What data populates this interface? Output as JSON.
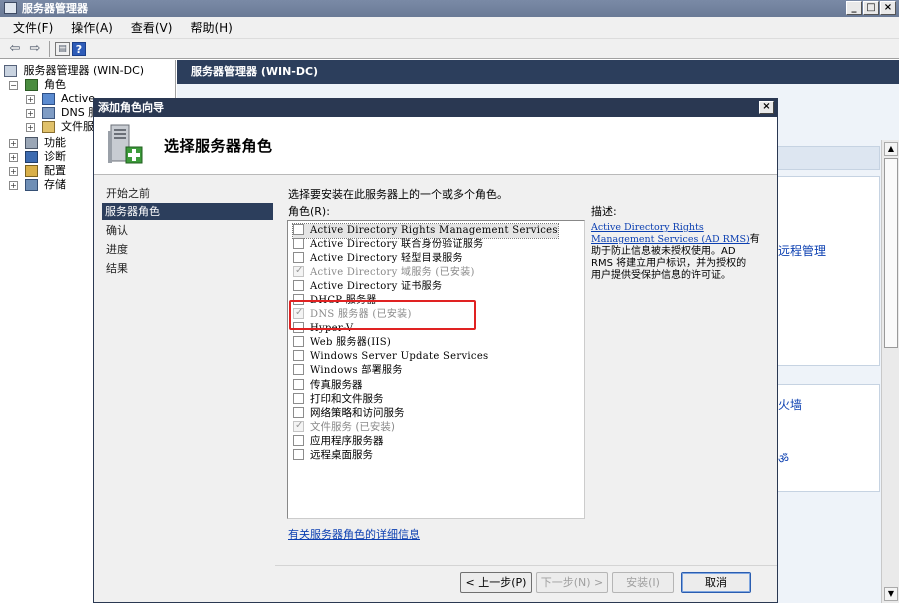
{
  "window": {
    "title": "服务器管理器",
    "controls": [
      "_",
      "□",
      "×"
    ]
  },
  "menubar": {
    "items": [
      "文件(F)",
      "操作(A)",
      "查看(V)",
      "帮助(H)"
    ]
  },
  "toolbar": {
    "back": "⇦",
    "forward": "⇨",
    "help": "?"
  },
  "tree": {
    "root": "服务器管理器 (WIN-DC)",
    "roles": "角色",
    "roles_children": [
      "Active",
      "DNS 服",
      "文件服"
    ],
    "items": [
      "功能",
      "诊断",
      "配置",
      "存储"
    ]
  },
  "right": {
    "header": "服务器管理器 (WIN-DC)",
    "links": [
      "远程管理",
      "火墙",
      "ॐ"
    ]
  },
  "dialog": {
    "title": "添加角色向导",
    "close": "×",
    "heading": "选择服务器角色",
    "steps": [
      "开始之前",
      "服务器角色",
      "确认",
      "进度",
      "结果"
    ],
    "instruction": "选择要安装在此服务器上的一个或多个角色。",
    "roles_label": "角色(R):",
    "description_label": "描述:",
    "roles": [
      {
        "label": "Active Directory Rights Management Services",
        "checked": false,
        "disabled": false
      },
      {
        "label": "Active Directory 联合身份验证服务",
        "checked": false,
        "disabled": false
      },
      {
        "label": "Active Directory 轻型目录服务",
        "checked": false,
        "disabled": false
      },
      {
        "label": "Active Directory 域服务  (已安装)",
        "checked": true,
        "disabled": true
      },
      {
        "label": "Active Directory 证书服务",
        "checked": false,
        "disabled": false
      },
      {
        "label": "DHCP 服务器",
        "checked": false,
        "disabled": false
      },
      {
        "label": "DNS 服务器  (已安装)",
        "checked": true,
        "disabled": true
      },
      {
        "label": "Hyper-V",
        "checked": false,
        "disabled": false
      },
      {
        "label": "Web 服务器(IIS)",
        "checked": false,
        "disabled": false
      },
      {
        "label": "Windows Server Update Services",
        "checked": false,
        "disabled": false
      },
      {
        "label": "Windows 部署服务",
        "checked": false,
        "disabled": false
      },
      {
        "label": "传真服务器",
        "checked": false,
        "disabled": false
      },
      {
        "label": "打印和文件服务",
        "checked": false,
        "disabled": false
      },
      {
        "label": "网络策略和访问服务",
        "checked": false,
        "disabled": false
      },
      {
        "label": "文件服务  (已安装)",
        "checked": true,
        "disabled": true
      },
      {
        "label": "应用程序服务器",
        "checked": false,
        "disabled": false
      },
      {
        "label": "远程桌面服务",
        "checked": false,
        "disabled": false
      }
    ],
    "description_link_1": "Active Directory Rights",
    "description_link_2": "Management Services (AD RMS)",
    "description_text_1": "有",
    "description_text_2": "助于防止信息被未授权使用。AD",
    "description_text_3": "RMS 将建立用户标识，并为授权的",
    "description_text_4": "用户提供受保护信息的许可证。",
    "more_info_link": "有关服务器角色的详细信息",
    "buttons": {
      "back": "< 上一步(P)",
      "next": "下一步(N) >",
      "install": "安装(I)",
      "cancel": "取消"
    }
  },
  "colors": {
    "title_bar": "#2a3852",
    "header_bar": "#2c3e5c",
    "link": "#0b3fb1",
    "highlight_box": "#e02222"
  }
}
